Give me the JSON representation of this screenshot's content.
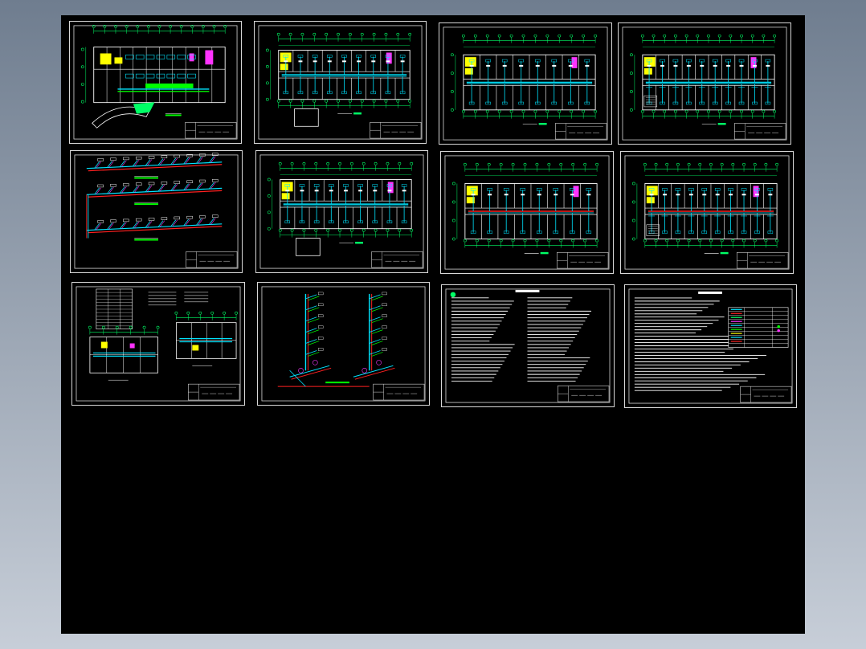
{
  "viewer": {
    "background_gradient": [
      "#6f7d8f",
      "#c7ced8"
    ],
    "canvas_color": "#000000"
  },
  "palette": {
    "wall": "#ffffff",
    "grid": "#00ff66",
    "pipe": "#00e5ff",
    "duct": "#00e5ff",
    "room_fill": "#ffff00",
    "equipment": "#ff33ff",
    "return_pipe": "#ff2020",
    "green_line": "#00ff00",
    "frame": "#d8d8d8"
  },
  "sheets": [
    {
      "id": "site-plan",
      "kind": "plan_site"
    },
    {
      "id": "plan-1",
      "kind": "plan_stair"
    },
    {
      "id": "plan-2",
      "kind": "plan"
    },
    {
      "id": "plan-3",
      "kind": "plan_dense"
    },
    {
      "id": "system-diagram",
      "kind": "system"
    },
    {
      "id": "plan-4",
      "kind": "plan_stair"
    },
    {
      "id": "plan-5",
      "kind": "plan_red"
    },
    {
      "id": "plan-6",
      "kind": "plan_red_dense"
    },
    {
      "id": "detail-sheet",
      "kind": "detail"
    },
    {
      "id": "riser-diagram",
      "kind": "riser"
    },
    {
      "id": "notes-sheet",
      "kind": "notes"
    },
    {
      "id": "legend-sheet",
      "kind": "legend"
    }
  ]
}
